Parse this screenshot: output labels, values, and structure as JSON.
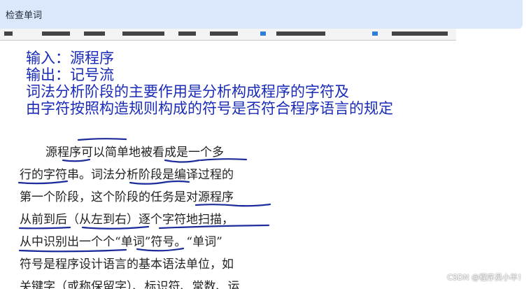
{
  "header": {
    "title": "检查单词"
  },
  "slide": {
    "lines": [
      "输入：源程序",
      "输出：记号流",
      "词法分析阶段的主要作用是分析构成程序的字符及",
      "由字符按照构造规则构成的符号是否符合程序语言的规定"
    ]
  },
  "book": {
    "lines": [
      "源程序可以简单地被看成是一个多",
      "行的字符串。词法分析阶段是编译过程的",
      "第一个阶段，这个阶段的任务是对源程序",
      "从前到后（从左到右）逐个字符地扫描，",
      "从中识别出一个个“单词”符号。“单词”",
      "符号是程序设计语言的基本语法单位，如",
      "关键字（或称保留字）、标识符、常数、运"
    ]
  },
  "watermark": "CSDN @程序员小羊！",
  "colors": {
    "header_bg": "#dbe7fb",
    "slide_text": "#1a2bb8",
    "annotation_ink": "#1c2c9a"
  }
}
